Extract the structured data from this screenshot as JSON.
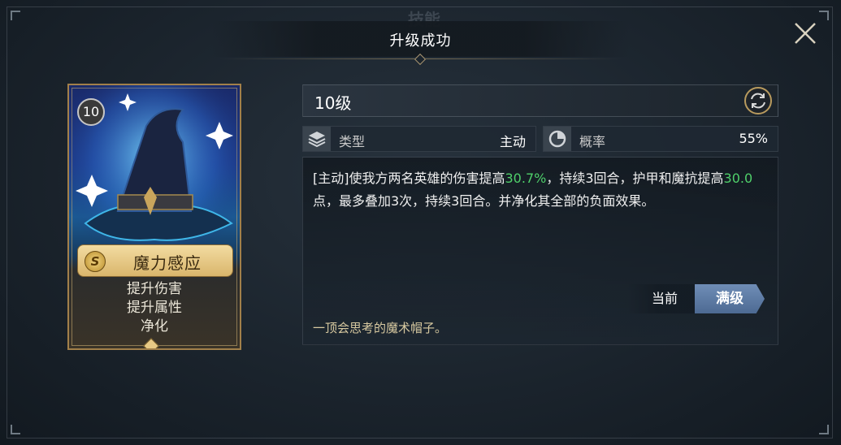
{
  "window": {
    "ghost_title": "技能",
    "title": "升级成功"
  },
  "card": {
    "level": "10",
    "rank_letter": "S",
    "skill_name": "魔力感应",
    "tags": [
      "提升伤害",
      "提升属性",
      "净化"
    ]
  },
  "skill": {
    "level_label": "10级",
    "type_label": "类型",
    "type_value": "主动",
    "chance_label": "概率",
    "chance_value": "55%",
    "description": {
      "part1": "[主动]使我方两名英雄的伤害提高",
      "damage_bonus": "30.7%",
      "part2": "，持续3回合，护甲和魔抗提高",
      "armor_bonus": "30.0",
      "part3": "点，最多叠加3次，持续3回合。并净化其全部的负面效果。"
    },
    "tab_current": "当前",
    "tab_max": "满级",
    "flavor": "一顶会思考的魔术帽子。"
  },
  "icons": {
    "close": "close-icon",
    "refresh": "refresh-icon",
    "type": "layers-icon",
    "chance": "pie-chart-icon"
  },
  "colors": {
    "highlight": "#4fd06a",
    "gold": "#a2804a",
    "tab_active": "#5a78a2"
  }
}
